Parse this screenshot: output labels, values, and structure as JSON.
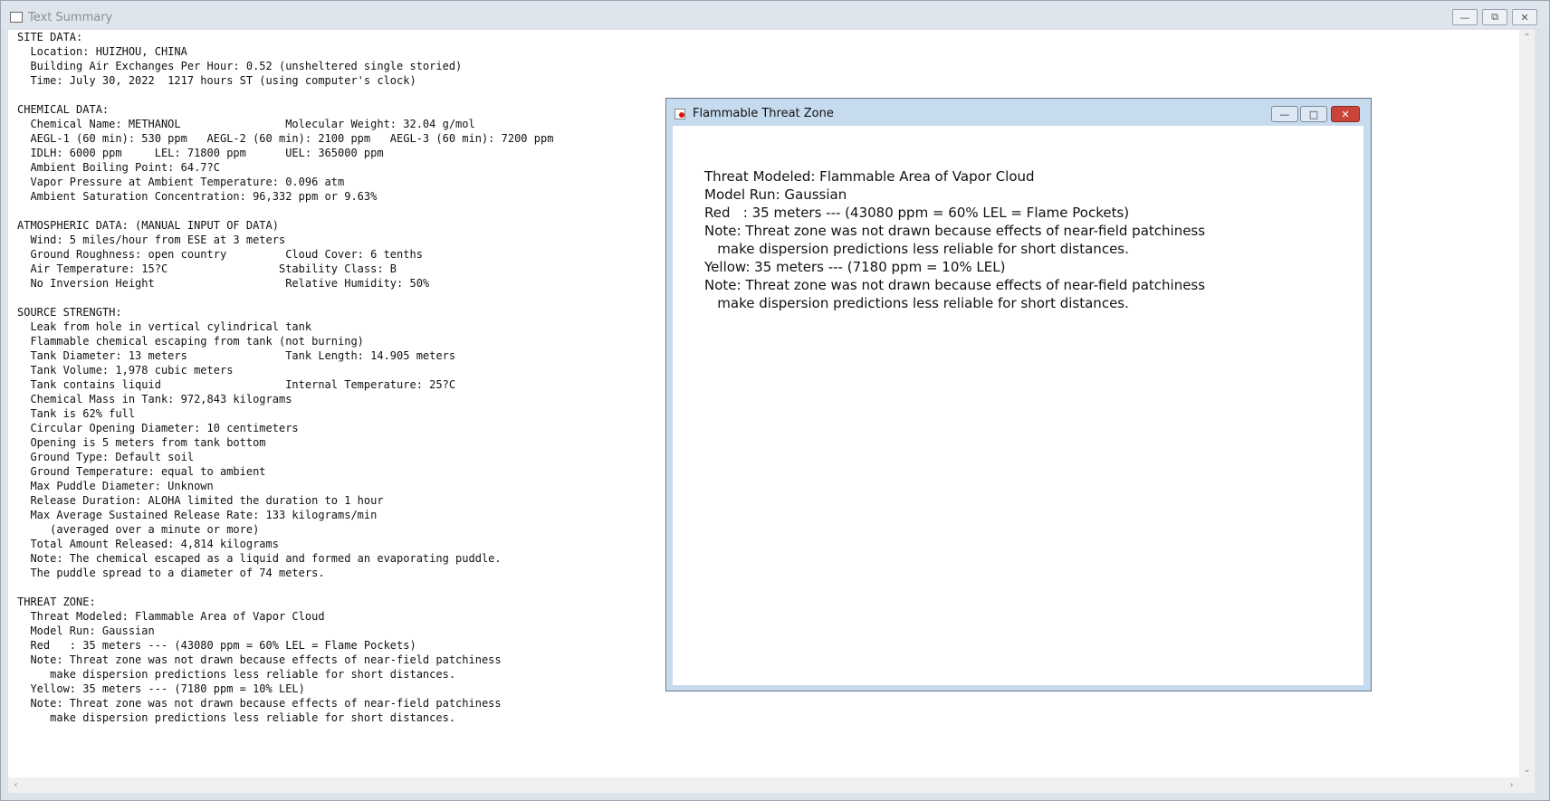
{
  "main_window": {
    "title": "Text Summary",
    "summary_lines": [
      "SITE DATA:",
      "  Location: HUIZHOU, CHINA",
      "  Building Air Exchanges Per Hour: 0.52 (unsheltered single storied)",
      "  Time: July 30, 2022  1217 hours ST (using computer's clock)",
      "",
      "CHEMICAL DATA:",
      "  Chemical Name: METHANOL                Molecular Weight: 32.04 g/mol",
      "  AEGL-1 (60 min): 530 ppm   AEGL-2 (60 min): 2100 ppm   AEGL-3 (60 min): 7200 ppm",
      "  IDLH: 6000 ppm     LEL: 71800 ppm      UEL: 365000 ppm",
      "  Ambient Boiling Point: 64.7?C",
      "  Vapor Pressure at Ambient Temperature: 0.096 atm",
      "  Ambient Saturation Concentration: 96,332 ppm or 9.63%",
      "",
      "ATMOSPHERIC DATA: (MANUAL INPUT OF DATA)",
      "  Wind: 5 miles/hour from ESE at 3 meters",
      "  Ground Roughness: open country         Cloud Cover: 6 tenths",
      "  Air Temperature: 15?C                 Stability Class: B",
      "  No Inversion Height                    Relative Humidity: 50%",
      "",
      "SOURCE STRENGTH:",
      "  Leak from hole in vertical cylindrical tank",
      "  Flammable chemical escaping from tank (not burning)",
      "  Tank Diameter: 13 meters               Tank Length: 14.905 meters",
      "  Tank Volume: 1,978 cubic meters",
      "  Tank contains liquid                   Internal Temperature: 25?C",
      "  Chemical Mass in Tank: 972,843 kilograms",
      "  Tank is 62% full",
      "  Circular Opening Diameter: 10 centimeters",
      "  Opening is 5 meters from tank bottom",
      "  Ground Type: Default soil",
      "  Ground Temperature: equal to ambient",
      "  Max Puddle Diameter: Unknown",
      "  Release Duration: ALOHA limited the duration to 1 hour",
      "  Max Average Sustained Release Rate: 133 kilograms/min",
      "     (averaged over a minute or more)",
      "  Total Amount Released: 4,814 kilograms",
      "  Note: The chemical escaped as a liquid and formed an evaporating puddle.",
      "  The puddle spread to a diameter of 74 meters.",
      "",
      "THREAT ZONE:",
      "  Threat Modeled: Flammable Area of Vapor Cloud",
      "  Model Run: Gaussian",
      "  Red   : 35 meters --- (43080 ppm = 60% LEL = Flame Pockets)",
      "  Note: Threat zone was not drawn because effects of near-field patchiness",
      "     make dispersion predictions less reliable for short distances.",
      "  Yellow: 35 meters --- (7180 ppm = 10% LEL)",
      "  Note: Threat zone was not drawn because effects of near-field patchiness",
      "     make dispersion predictions less reliable for short distances."
    ]
  },
  "popup_window": {
    "title": "Flammable Threat Zone",
    "lines": [
      "Threat Modeled: Flammable Area of Vapor Cloud",
      "Model Run: Gaussian",
      "Red   : 35 meters --- (43080 ppm = 60% LEL = Flame Pockets)",
      "Note: Threat zone was not drawn because effects of near-field patchiness",
      "   make dispersion predictions less reliable for short distances.",
      "Yellow: 35 meters --- (7180 ppm = 10% LEL)",
      "Note: Threat zone was not drawn because effects of near-field patchiness",
      "   make dispersion predictions less reliable for short distances."
    ]
  },
  "icons": {
    "minimize": "minimize-icon",
    "maximize": "maximize-icon",
    "close": "close-icon"
  }
}
